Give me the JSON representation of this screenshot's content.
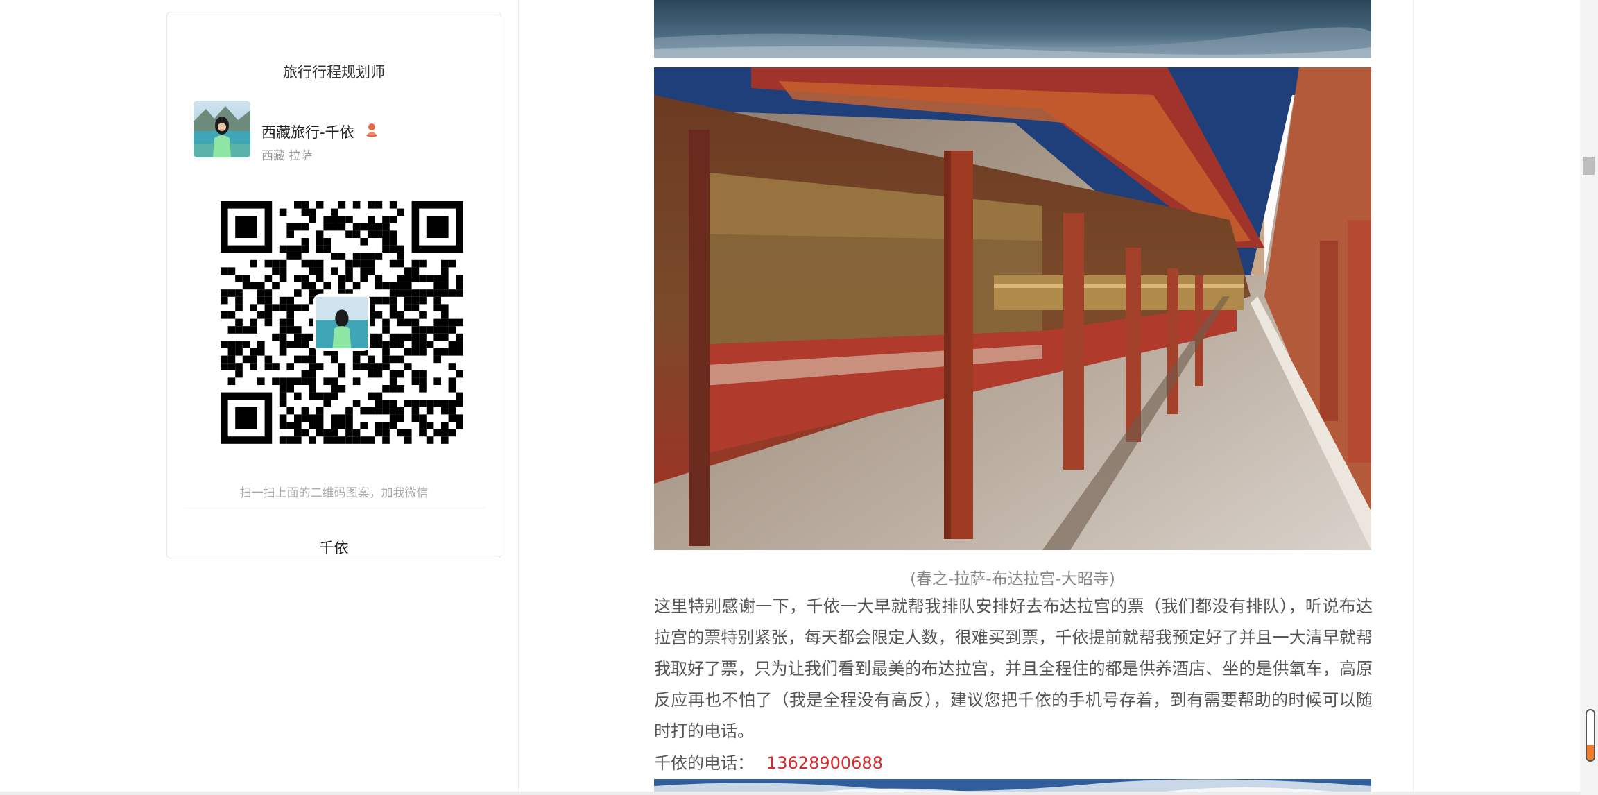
{
  "sidebar": {
    "card_title": "旅行行程规划师",
    "profile": {
      "name": "西藏旅行-千依",
      "location": "西藏 拉萨",
      "gender_icon": "female-person-icon"
    },
    "qr_hint": "扫一扫上面的二维码图案，加我微信",
    "footer_name": "千依"
  },
  "article": {
    "caption": "(春之-拉萨-布达拉宫-大昭寺)",
    "paragraph": "这里特别感谢一下，千依一大早就帮我排队安排好去布达拉宫的票（我们都没有排队），听说布达拉宫的票特别紧张，每天都会限定人数，很难买到票，千依提前就帮我预定好了并且一大清早就帮我取好了票，只为让我们看到最美的布达拉宫，并且全程住的都是供养酒店、坐的是供氧车，高原反应再也不怕了（我是全程没有高反），建议您把千依的手机号存着，到有需要帮助的时候可以随时打的电话。",
    "phone_label": "千依的电话：",
    "phone_number": "13628900688"
  },
  "colors": {
    "phone": "#d9292b",
    "caption": "#888888",
    "scroll_indicator": "#f07c2b"
  }
}
